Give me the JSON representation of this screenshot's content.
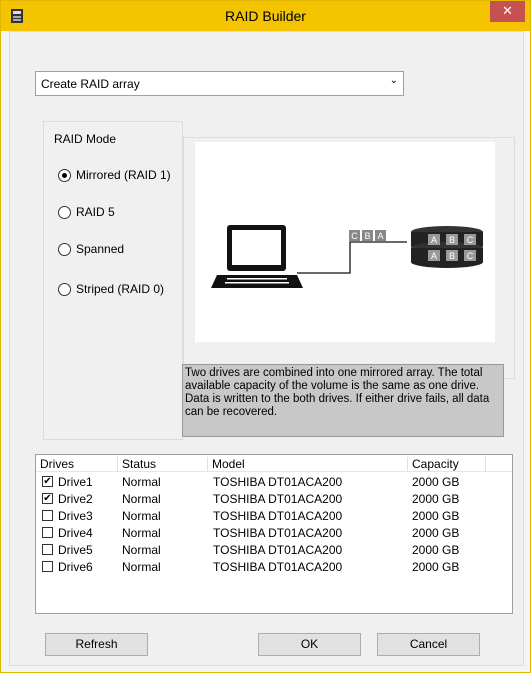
{
  "window": {
    "title": "RAID Builder",
    "close_glyph": "✕"
  },
  "action_select": {
    "value": "Create RAID array",
    "arrow": "⌄"
  },
  "raid_mode": {
    "title": "RAID Mode",
    "options": [
      {
        "label": "Mirrored (RAID 1)",
        "selected": true
      },
      {
        "label": "RAID 5",
        "selected": false
      },
      {
        "label": "Spanned",
        "selected": false
      },
      {
        "label": "Striped (RAID 0)",
        "selected": false
      }
    ]
  },
  "illustration": {
    "packets": [
      "C",
      "B",
      "A"
    ],
    "disk_row1": [
      "A",
      "B",
      "C"
    ],
    "disk_row2": [
      "A",
      "B",
      "C"
    ]
  },
  "description": "Two drives are combined into one mirrored array. The total available capacity of the volume is the same as one drive. Data is written to the both drives. If either drive fails, all data can be recovered.",
  "drives_table": {
    "columns": [
      "Drives",
      "Status",
      "Model",
      "Capacity"
    ],
    "rows": [
      {
        "checked": true,
        "drive": "Drive1",
        "status": "Normal",
        "model": "TOSHIBA DT01ACA200",
        "capacity": "2000 GB"
      },
      {
        "checked": true,
        "drive": "Drive2",
        "status": "Normal",
        "model": "TOSHIBA DT01ACA200",
        "capacity": "2000 GB"
      },
      {
        "checked": false,
        "drive": "Drive3",
        "status": "Normal",
        "model": "TOSHIBA DT01ACA200",
        "capacity": "2000 GB"
      },
      {
        "checked": false,
        "drive": "Drive4",
        "status": "Normal",
        "model": "TOSHIBA DT01ACA200",
        "capacity": "2000 GB"
      },
      {
        "checked": false,
        "drive": "Drive5",
        "status": "Normal",
        "model": "TOSHIBA DT01ACA200",
        "capacity": "2000 GB"
      },
      {
        "checked": false,
        "drive": "Drive6",
        "status": "Normal",
        "model": "TOSHIBA DT01ACA200",
        "capacity": "2000 GB"
      }
    ]
  },
  "buttons": {
    "refresh": "Refresh",
    "ok": "OK",
    "cancel": "Cancel"
  }
}
